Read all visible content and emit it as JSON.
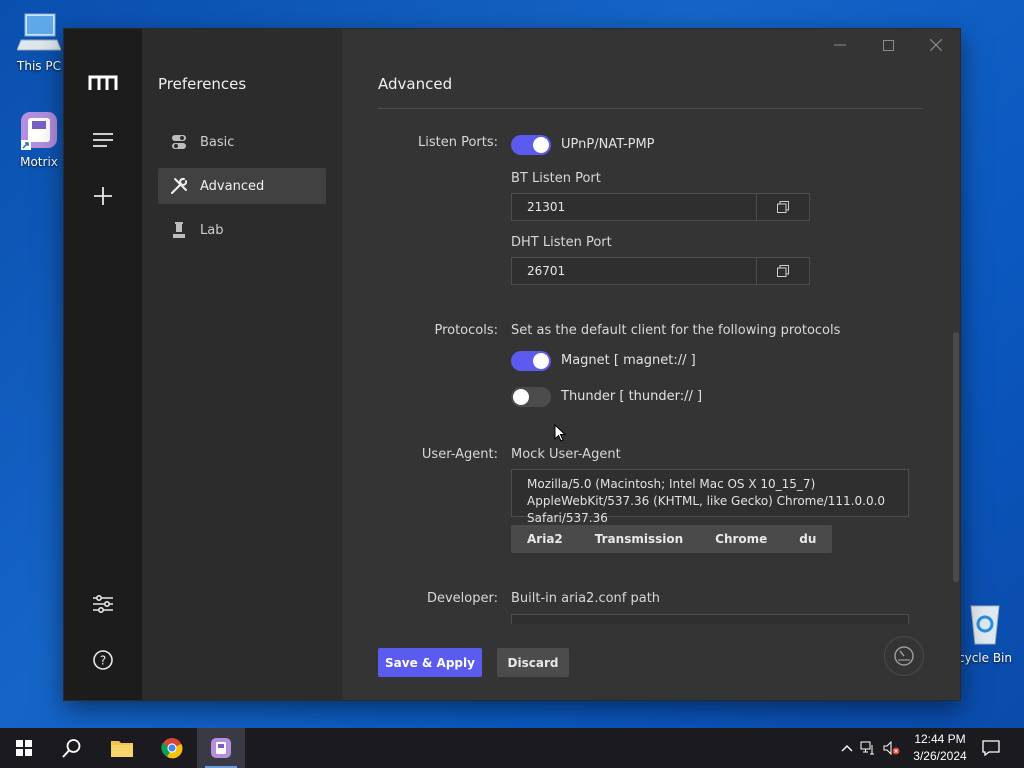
{
  "desktop": {
    "icons": [
      {
        "label": "This PC"
      },
      {
        "label": "Motrix"
      },
      {
        "label": "cycle Bin"
      }
    ]
  },
  "sidebar": {
    "title": "Preferences",
    "items": [
      {
        "label": "Basic",
        "icon": "toggle-icon"
      },
      {
        "label": "Advanced",
        "icon": "wrench-tools-icon",
        "active": true
      },
      {
        "label": "Lab",
        "icon": "flask-icon"
      }
    ]
  },
  "main": {
    "title": "Advanced",
    "listen_ports": {
      "label": "Listen Ports:",
      "upnp_label": "UPnP/NAT-PMP",
      "upnp_enabled": true,
      "bt_label": "BT Listen Port",
      "bt_value": "21301",
      "dht_label": "DHT Listen Port",
      "dht_value": "26701"
    },
    "protocols": {
      "label": "Protocols:",
      "description": "Set as the default client for the following protocols",
      "magnet_label": "Magnet [ magnet:// ]",
      "magnet_enabled": true,
      "thunder_label": "Thunder [ thunder:// ]",
      "thunder_enabled": false
    },
    "user_agent": {
      "label": "User-Agent:",
      "field_label": "Mock User-Agent",
      "value": "Mozilla/5.0 (Macintosh; Intel Mac OS X 10_15_7) AppleWebKit/537.36 (KHTML, like Gecko) Chrome/111.0.0.0 Safari/537.36",
      "presets": [
        "Aria2",
        "Transmission",
        "Chrome",
        "du"
      ]
    },
    "developer": {
      "label": "Developer:",
      "field_label": "Built-in aria2.conf path"
    },
    "actions": {
      "save": "Save & Apply",
      "discard": "Discard"
    }
  },
  "taskbar": {
    "time": "12:44 PM",
    "date": "3/26/2024"
  },
  "colors": {
    "accent": "#5b5bf0",
    "window_bg": "#343434",
    "rail_bg": "#1c1c1c"
  }
}
